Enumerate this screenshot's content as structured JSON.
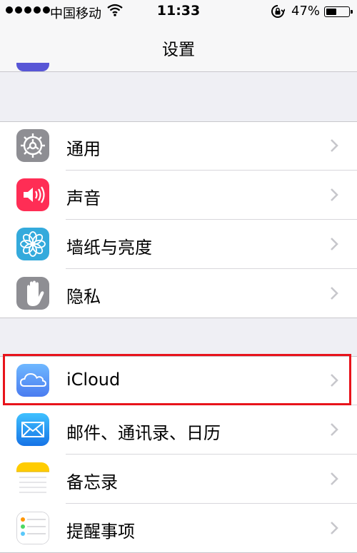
{
  "status_bar": {
    "carrier": "中国移动",
    "time": "11:33",
    "battery_percent": "47%",
    "battery_level": 0.47,
    "signal_bars": 5
  },
  "nav": {
    "title": "设置"
  },
  "groups": [
    {
      "rows": [
        {
          "label": "通用",
          "icon": "gear-icon",
          "icon_color": "#8e8e93"
        },
        {
          "label": "声音",
          "icon": "speaker-icon",
          "icon_color": "#ff2d55"
        },
        {
          "label": "墙纸与亮度",
          "icon": "flower-icon",
          "icon_color": "#34aadc"
        },
        {
          "label": "隐私",
          "icon": "hand-icon",
          "icon_color": "#8e8e93"
        }
      ]
    },
    {
      "rows": [
        {
          "label": "iCloud",
          "icon": "cloud-icon",
          "icon_color": "#5ac8fa"
        },
        {
          "label": "邮件、通讯录、日历",
          "icon": "mail-icon",
          "icon_color": "#1e88f0"
        },
        {
          "label": "备忘录",
          "icon": "notes-icon",
          "icon_color": "#ffcc00"
        },
        {
          "label": "提醒事项",
          "icon": "reminders-icon",
          "icon_color": "#ffffff"
        }
      ]
    }
  ],
  "highlight_color": "#e8131b"
}
